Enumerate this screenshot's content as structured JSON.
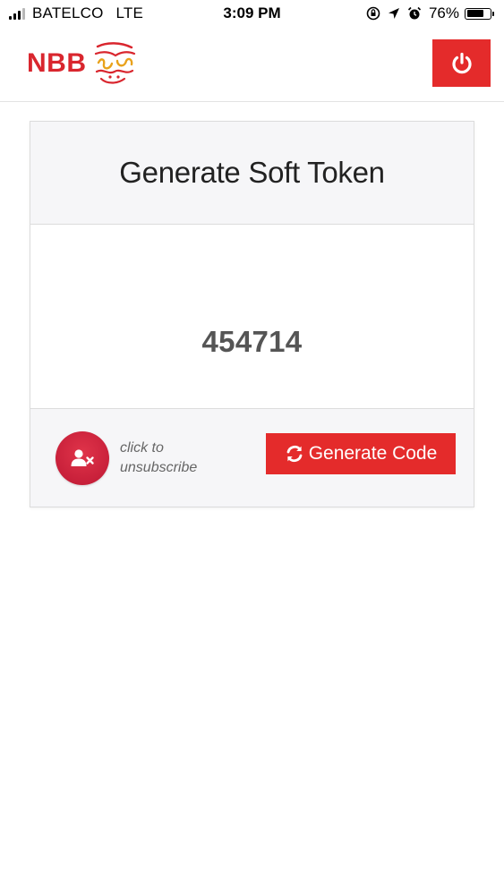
{
  "status_bar": {
    "carrier": "BATELCO",
    "network": "LTE",
    "time": "3:09 PM",
    "battery_percent": "76%",
    "battery_level": 0.76,
    "icons": [
      "orientation-lock-icon",
      "location-arrow-icon",
      "alarm-icon"
    ]
  },
  "header": {
    "logo_text": "NBB",
    "brand_color": "#d9262e",
    "power_button_icon": "power-icon",
    "power_button_color": "#e42b2b"
  },
  "card": {
    "title": "Generate Soft Token",
    "token_code": "454714",
    "unsubscribe_hint": "click to unsubscribe",
    "unsubscribe_icon": "user-remove-icon",
    "generate_button_label": "Generate Code",
    "generate_button_icon": "refresh-icon",
    "accent_color": "#e42b2b"
  }
}
